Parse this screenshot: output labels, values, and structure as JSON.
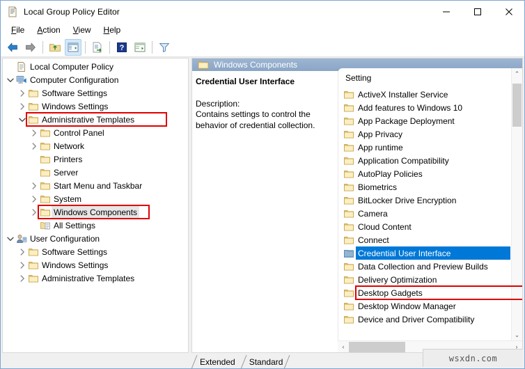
{
  "window": {
    "title": "Local Group Policy Editor",
    "icon": "policy-document-icon",
    "minimize_label": "—",
    "maximize_label": "□",
    "close_label": "✕"
  },
  "menubar": {
    "items": [
      {
        "label": "File",
        "accel": "F"
      },
      {
        "label": "Action",
        "accel": "A"
      },
      {
        "label": "View",
        "accel": "V"
      },
      {
        "label": "Help",
        "accel": "H"
      }
    ]
  },
  "toolbar": {
    "buttons": [
      {
        "name": "back-icon",
        "title": "Back"
      },
      {
        "name": "forward-icon",
        "title": "Forward"
      },
      {
        "name": "up-folder-icon",
        "title": "Up One Level"
      },
      {
        "name": "show-hide-console-tree-icon",
        "title": "Show/Hide Console Tree",
        "active": true
      },
      {
        "name": "export-list-icon",
        "title": "Export List"
      },
      {
        "name": "help-icon",
        "title": "Help"
      },
      {
        "name": "show-hide-action-pane-icon",
        "title": "Show/Hide Action Pane"
      },
      {
        "name": "filter-icon",
        "title": "Filter"
      }
    ]
  },
  "tree": {
    "nodes": [
      {
        "label": "Local Computer Policy",
        "indent": 0,
        "twisty": "none",
        "icon": "policy-document-icon",
        "highlight": false,
        "selected": false
      },
      {
        "label": "Computer Configuration",
        "indent": 0,
        "twisty": "expanded",
        "icon": "computer-icon",
        "highlight": false,
        "selected": false
      },
      {
        "label": "Software Settings",
        "indent": 1,
        "twisty": "collapsed",
        "icon": "folder-icon",
        "highlight": false,
        "selected": false
      },
      {
        "label": "Windows Settings",
        "indent": 1,
        "twisty": "collapsed",
        "icon": "folder-icon",
        "highlight": false,
        "selected": false
      },
      {
        "label": "Administrative Templates",
        "indent": 1,
        "twisty": "expanded",
        "icon": "folder-icon",
        "highlight": true,
        "selected": false
      },
      {
        "label": "Control Panel",
        "indent": 2,
        "twisty": "collapsed",
        "icon": "folder-icon",
        "highlight": false,
        "selected": false
      },
      {
        "label": "Network",
        "indent": 2,
        "twisty": "collapsed",
        "icon": "folder-icon",
        "highlight": false,
        "selected": false
      },
      {
        "label": "Printers",
        "indent": 2,
        "twisty": "none",
        "icon": "folder-icon",
        "highlight": false,
        "selected": false
      },
      {
        "label": "Server",
        "indent": 2,
        "twisty": "none",
        "icon": "folder-icon",
        "highlight": false,
        "selected": false
      },
      {
        "label": "Start Menu and Taskbar",
        "indent": 2,
        "twisty": "collapsed",
        "icon": "folder-icon",
        "highlight": false,
        "selected": false
      },
      {
        "label": "System",
        "indent": 2,
        "twisty": "collapsed",
        "icon": "folder-icon",
        "highlight": false,
        "selected": false
      },
      {
        "label": "Windows Components",
        "indent": 2,
        "twisty": "collapsed",
        "icon": "folder-icon",
        "highlight": true,
        "selected": true
      },
      {
        "label": "All Settings",
        "indent": 2,
        "twisty": "none",
        "icon": "all-settings-icon",
        "highlight": false,
        "selected": false
      },
      {
        "label": "User Configuration",
        "indent": 0,
        "twisty": "expanded",
        "icon": "user-icon",
        "highlight": false,
        "selected": false
      },
      {
        "label": "Software Settings",
        "indent": 1,
        "twisty": "collapsed",
        "icon": "folder-icon",
        "highlight": false,
        "selected": false
      },
      {
        "label": "Windows Settings",
        "indent": 1,
        "twisty": "collapsed",
        "icon": "folder-icon",
        "highlight": false,
        "selected": false
      },
      {
        "label": "Administrative Templates",
        "indent": 1,
        "twisty": "collapsed",
        "icon": "folder-icon",
        "highlight": false,
        "selected": false
      }
    ]
  },
  "right_pane": {
    "header_title": "Windows Components",
    "header_icon": "folder-icon",
    "description": {
      "title": "Credential User Interface",
      "label": "Description:",
      "text": "Contains settings to control the behavior of credential collection."
    },
    "list": {
      "column_header": "Setting",
      "items": [
        {
          "label": "ActiveX Installer Service",
          "icon": "folder-icon",
          "selected": false
        },
        {
          "label": "Add features to Windows 10",
          "icon": "folder-icon",
          "selected": false
        },
        {
          "label": "App Package Deployment",
          "icon": "folder-icon",
          "selected": false
        },
        {
          "label": "App Privacy",
          "icon": "folder-icon",
          "selected": false
        },
        {
          "label": "App runtime",
          "icon": "folder-icon",
          "selected": false
        },
        {
          "label": "Application Compatibility",
          "icon": "folder-icon",
          "selected": false
        },
        {
          "label": "AutoPlay Policies",
          "icon": "folder-icon",
          "selected": false
        },
        {
          "label": "Biometrics",
          "icon": "folder-icon",
          "selected": false
        },
        {
          "label": "BitLocker Drive Encryption",
          "icon": "folder-icon",
          "selected": false
        },
        {
          "label": "Camera",
          "icon": "folder-icon",
          "selected": false
        },
        {
          "label": "Cloud Content",
          "icon": "folder-icon",
          "selected": false
        },
        {
          "label": "Connect",
          "icon": "folder-icon",
          "selected": false
        },
        {
          "label": "Credential User Interface",
          "icon": "folder-icon",
          "selected": true
        },
        {
          "label": "Data Collection and Preview Builds",
          "icon": "folder-icon",
          "selected": false
        },
        {
          "label": "Delivery Optimization",
          "icon": "folder-icon",
          "selected": false
        },
        {
          "label": "Desktop Gadgets",
          "icon": "folder-icon",
          "selected": false
        },
        {
          "label": "Desktop Window Manager",
          "icon": "folder-icon",
          "selected": false
        },
        {
          "label": "Device and Driver Compatibility",
          "icon": "folder-icon",
          "selected": false
        }
      ]
    },
    "scroll": {
      "up_arrow": "⌃",
      "down_arrow": "⌄",
      "left_arrow": "‹",
      "right_arrow": "›"
    }
  },
  "tabs": {
    "items": [
      {
        "label": "Extended",
        "active": false
      },
      {
        "label": "Standard",
        "active": true
      }
    ]
  },
  "watermark": {
    "text": "wsxdn.com"
  },
  "colors": {
    "selection_blue": "#0078d7",
    "highlight_red": "#e00000",
    "header_blue": "#8ba7c9",
    "window_border": "#7ba7d1",
    "folder_yellow": "#f5dfa0"
  }
}
